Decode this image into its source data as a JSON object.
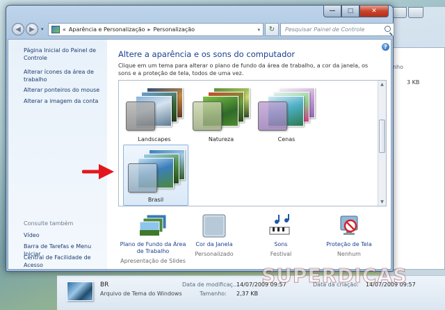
{
  "window": {
    "back_glyph": "◀",
    "forward_glyph": "▶",
    "dropdown_glyph": "▾",
    "refresh_glyph": "↻",
    "minimize_glyph": "—",
    "maximize_glyph": "□",
    "close_glyph": "✕"
  },
  "address": {
    "prefix": "«",
    "crumb1": "Aparência e Personalização",
    "separator": "▸",
    "crumb2": "Personalização"
  },
  "search": {
    "placeholder": "Pesquisar Painel de Controle"
  },
  "sidebar": {
    "links": [
      "Página Inicial do Painel de Controle",
      "Alterar ícones da área de trabalho",
      "Alterar ponteiros do mouse",
      "Alterar a imagem da conta"
    ],
    "see_also_heading": "Consulte também",
    "see_also": [
      "Vídeo",
      "Barra de Tarefas e Menu Iniciar",
      "Central de Facilidade de Acesso"
    ]
  },
  "main": {
    "help_glyph": "?",
    "title": "Altere a aparência e os sons do computador",
    "description": "Clique em um tema para alterar o plano de fundo da área de trabalho, a cor da janela, os sons e a proteção de tela, todos de uma vez."
  },
  "themes": [
    {
      "label": "Landscapes",
      "selected": false
    },
    {
      "label": "Natureza",
      "selected": false
    },
    {
      "label": "Cenas",
      "selected": false
    },
    {
      "label": "Brasil",
      "selected": true
    }
  ],
  "options": [
    {
      "label": "Plano de Fundo da Área de Trabalho",
      "sub": "Apresentação de Slides"
    },
    {
      "label": "Cor da Janela",
      "sub": "Personalizado"
    },
    {
      "label": "Sons",
      "sub": "Festival"
    },
    {
      "label": "Proteção de Tela",
      "sub": "Nenhum"
    }
  ],
  "details": {
    "name": "BR",
    "type": "Arquivo de Tema do Windows",
    "modified_label": "Data de modificaç...",
    "modified_value": "14/07/2009 09:57",
    "created_label": "Data da criação:",
    "created_value": "14/07/2009 09:57",
    "size_label": "Tamanho:",
    "size_value": "2,37 KB"
  },
  "background_window": {
    "column_header": "nanho",
    "size_value": "3 KB"
  },
  "watermark": "SUPERDICAS",
  "colors": {
    "link": "#1a3f8f",
    "arrow": "#e4161d",
    "close": "#c7432a"
  }
}
